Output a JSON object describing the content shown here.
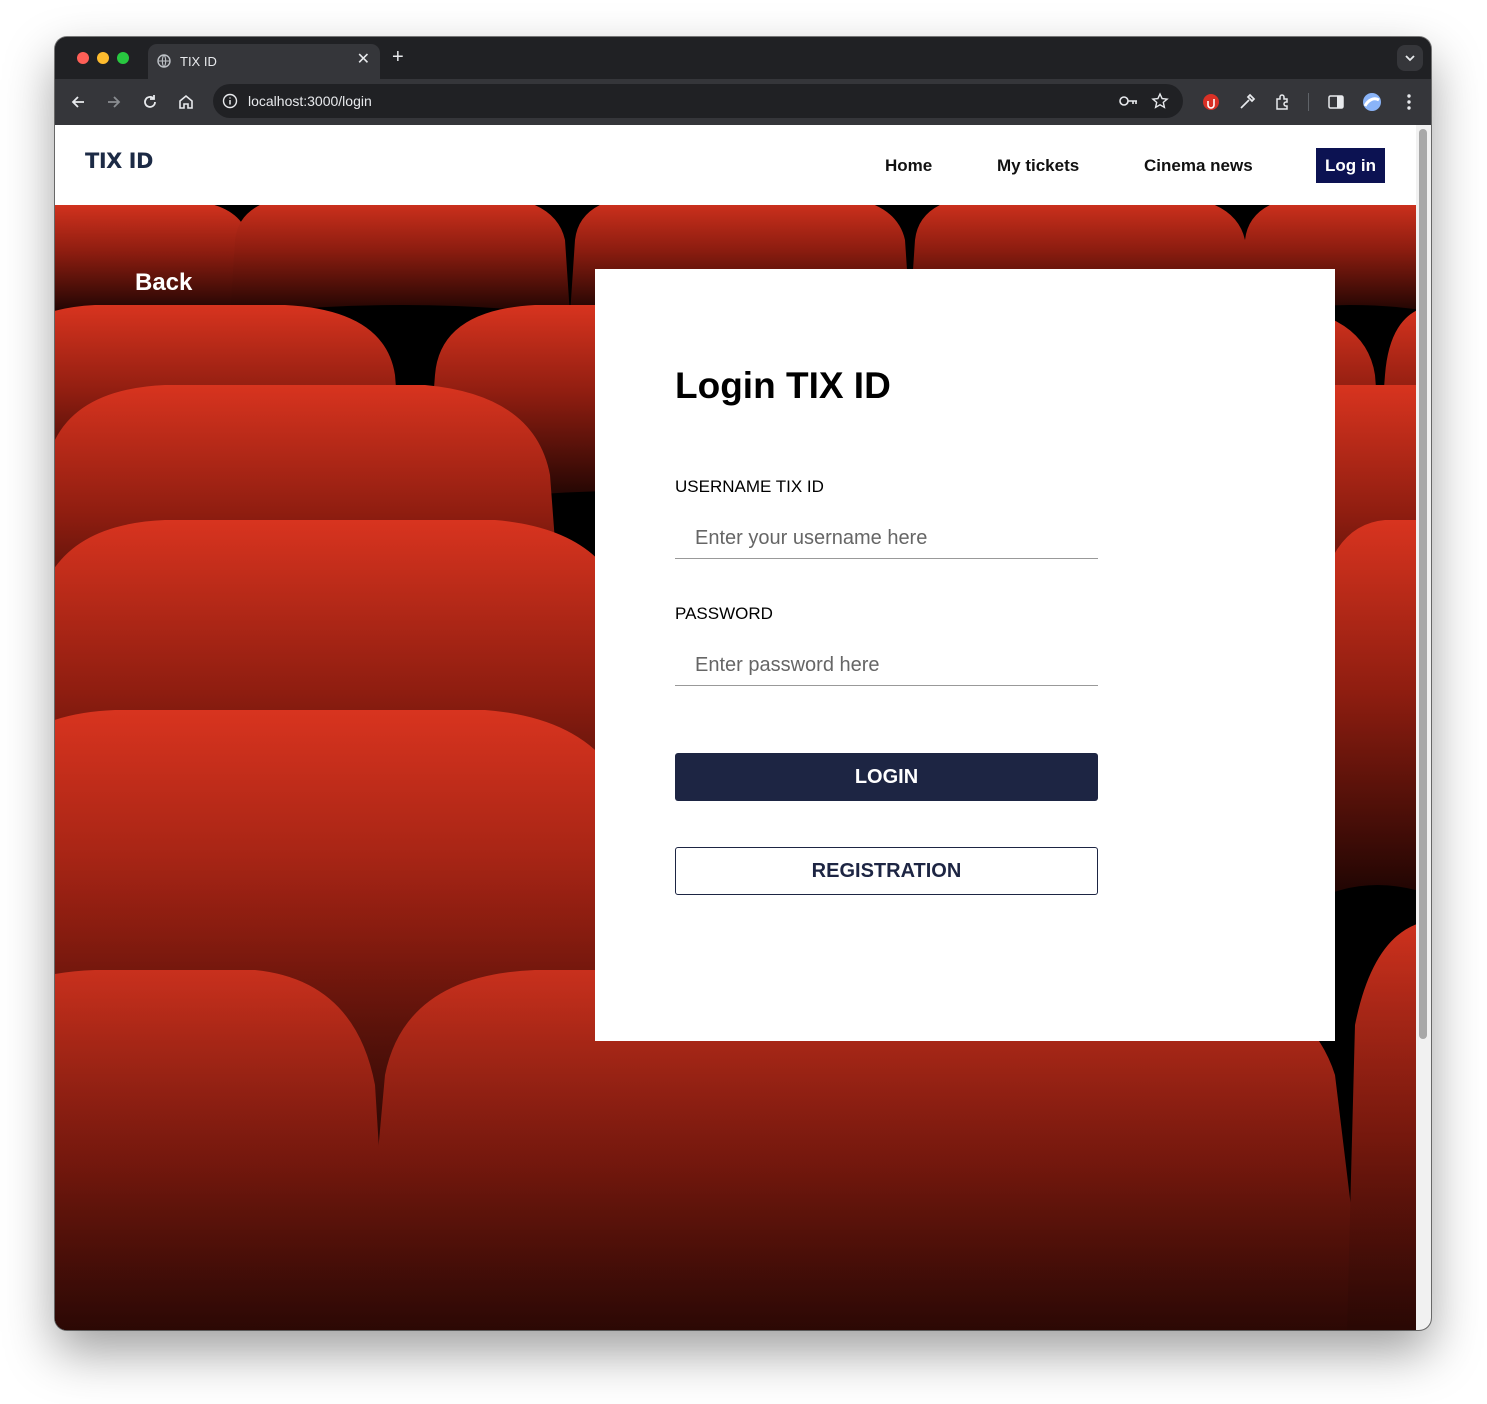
{
  "browser": {
    "tab_title": "TIX ID",
    "url": "localhost:3000/login"
  },
  "navbar": {
    "logo": "TIX ID",
    "links": [
      "Home",
      "My tickets",
      "Cinema news"
    ],
    "login_label": "Log in",
    "login_color": "#0c1252"
  },
  "page": {
    "back_label": "Back",
    "title": "Login TIX ID",
    "username_label": "USERNAME TIX ID",
    "username_placeholder": "Enter your username here",
    "password_label": "PASSWORD",
    "password_placeholder": "Enter password here",
    "login_button": "LOGIN",
    "registration_button": "REGISTRATION",
    "button_color": "#1d2543",
    "seat_color": "#c0281a"
  }
}
